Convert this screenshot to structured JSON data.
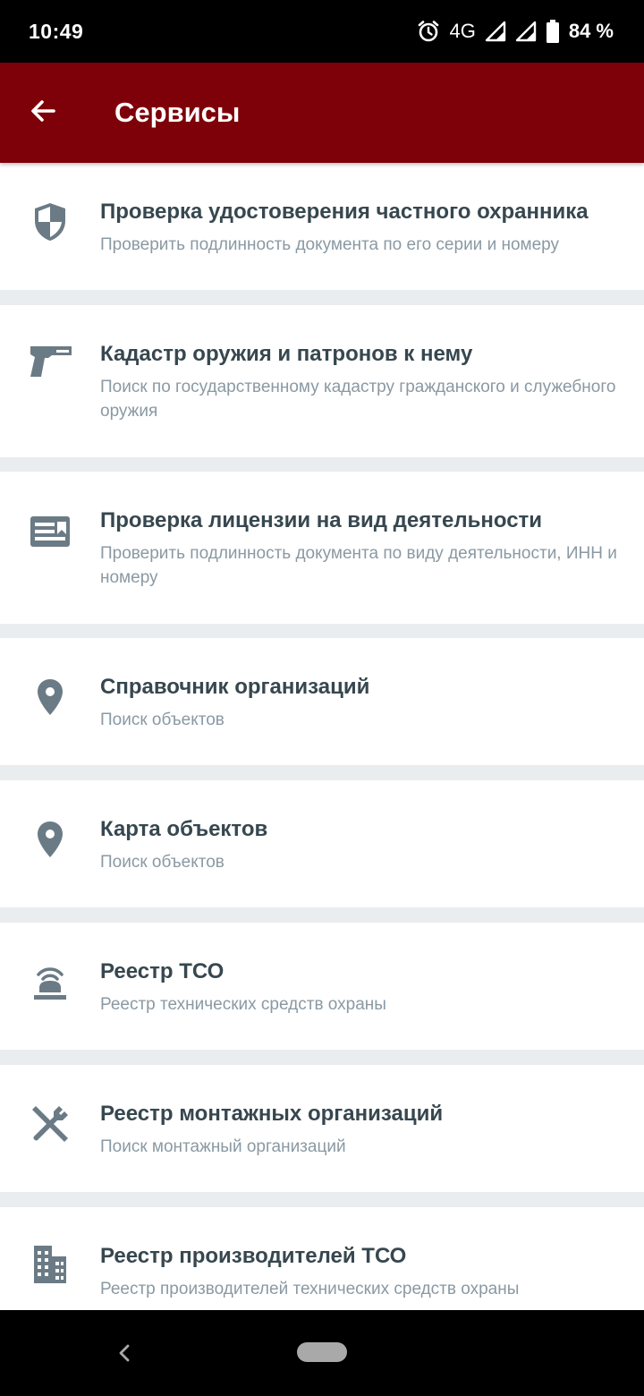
{
  "status_bar": {
    "time": "10:49",
    "network": "4G",
    "battery": "84 %",
    "icons": [
      "alarm-icon",
      "signal-icon",
      "signal-icon",
      "battery-icon"
    ]
  },
  "app_bar": {
    "title": "Сервисы",
    "back_icon": "arrow-left-icon"
  },
  "services": [
    {
      "icon": "shield-icon",
      "title": "Проверка удостоверения частного охранника",
      "subtitle": "Проверить подлинность документа по его серии и номеру"
    },
    {
      "icon": "pistol-icon",
      "title": "Кадастр оружия и патронов к нему",
      "subtitle": "Поиск по государственному кадастру гражданского и служебного оружия"
    },
    {
      "icon": "license-card-icon",
      "title": "Проверка лицензии на вид деятельности",
      "subtitle": "Проверить подлинность документа по виду деятельности, ИНН и номеру"
    },
    {
      "icon": "map-pin-icon",
      "title": "Справочник организаций",
      "subtitle": "Поиск объектов"
    },
    {
      "icon": "map-pin-icon",
      "title": "Карта объектов",
      "subtitle": "Поиск объектов"
    },
    {
      "icon": "alarm-beacon-icon",
      "title": "Реестр ТСО",
      "subtitle": "Реестр технических средств охраны"
    },
    {
      "icon": "tools-icon",
      "title": "Реестр монтажных организаций",
      "subtitle": "Поиск монтажный организаций"
    },
    {
      "icon": "building-icon",
      "title": "Реестр производителей ТСО",
      "subtitle": "Реестр производителей технических средств охраны"
    }
  ],
  "colors": {
    "app_bar": "#7e0008",
    "title_text": "#37474f",
    "subtitle_text": "#8a99a3",
    "icon": "#6b7b86",
    "divider": "#e9edf0"
  },
  "nav_bar": {
    "back_icon": "nav-back-icon",
    "home_icon": "nav-home-pill"
  }
}
